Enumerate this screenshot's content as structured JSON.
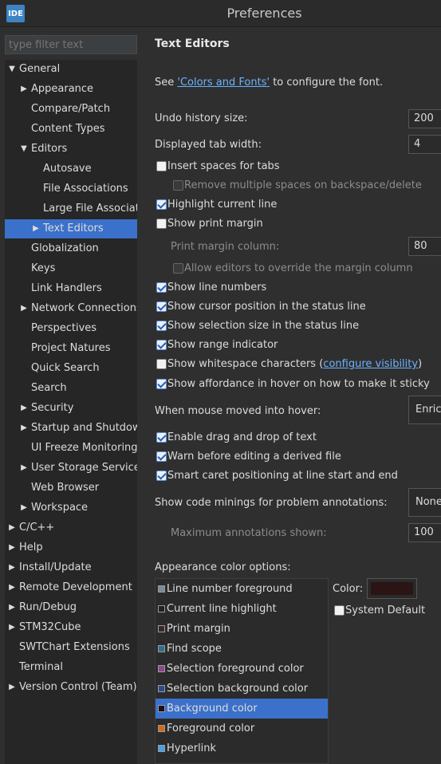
{
  "window": {
    "title": "Preferences",
    "logo": "IDE"
  },
  "filter": {
    "placeholder": "type filter text"
  },
  "tree": [
    {
      "label": "General",
      "depth": 0,
      "twisty": "open"
    },
    {
      "label": "Appearance",
      "depth": 1,
      "twisty": "closed"
    },
    {
      "label": "Compare/Patch",
      "depth": 1,
      "twisty": "none"
    },
    {
      "label": "Content Types",
      "depth": 1,
      "twisty": "none"
    },
    {
      "label": "Editors",
      "depth": 1,
      "twisty": "open"
    },
    {
      "label": "Autosave",
      "depth": 2,
      "twisty": "none"
    },
    {
      "label": "File Associations",
      "depth": 2,
      "twisty": "none"
    },
    {
      "label": "Large File Associatio",
      "depth": 2,
      "twisty": "none"
    },
    {
      "label": "Text Editors",
      "depth": 2,
      "twisty": "closed",
      "selected": true
    },
    {
      "label": "Globalization",
      "depth": 1,
      "twisty": "none"
    },
    {
      "label": "Keys",
      "depth": 1,
      "twisty": "none"
    },
    {
      "label": "Link Handlers",
      "depth": 1,
      "twisty": "none"
    },
    {
      "label": "Network Connections",
      "depth": 1,
      "twisty": "closed"
    },
    {
      "label": "Perspectives",
      "depth": 1,
      "twisty": "none"
    },
    {
      "label": "Project Natures",
      "depth": 1,
      "twisty": "none"
    },
    {
      "label": "Quick Search",
      "depth": 1,
      "twisty": "none"
    },
    {
      "label": "Search",
      "depth": 1,
      "twisty": "none"
    },
    {
      "label": "Security",
      "depth": 1,
      "twisty": "closed"
    },
    {
      "label": "Startup and Shutdown",
      "depth": 1,
      "twisty": "closed"
    },
    {
      "label": "UI Freeze Monitoring",
      "depth": 1,
      "twisty": "none"
    },
    {
      "label": "User Storage Service",
      "depth": 1,
      "twisty": "closed"
    },
    {
      "label": "Web Browser",
      "depth": 1,
      "twisty": "none"
    },
    {
      "label": "Workspace",
      "depth": 1,
      "twisty": "closed"
    },
    {
      "label": "C/C++",
      "depth": 0,
      "twisty": "closed"
    },
    {
      "label": "Help",
      "depth": 0,
      "twisty": "closed"
    },
    {
      "label": "Install/Update",
      "depth": 0,
      "twisty": "closed"
    },
    {
      "label": "Remote Development",
      "depth": 0,
      "twisty": "closed"
    },
    {
      "label": "Run/Debug",
      "depth": 0,
      "twisty": "closed"
    },
    {
      "label": "STM32Cube",
      "depth": 0,
      "twisty": "closed"
    },
    {
      "label": "SWTChart Extensions",
      "depth": 0,
      "twisty": "none"
    },
    {
      "label": "Terminal",
      "depth": 0,
      "twisty": "none"
    },
    {
      "label": "Version Control (Team)",
      "depth": 0,
      "twisty": "closed"
    }
  ],
  "page": {
    "title": "Text Editors",
    "see_prefix": "See ",
    "see_link": "'Colors and Fonts'",
    "see_suffix": " to configure the font.",
    "undo_label": "Undo history size:",
    "undo_value": "200",
    "tab_label": "Displayed tab width:",
    "tab_value": "4",
    "insert_spaces": "Insert spaces for tabs",
    "remove_spaces": "Remove multiple spaces on backspace/delete",
    "highlight_line": "Highlight current line",
    "show_print_margin": "Show print margin",
    "print_margin_label": "Print margin column:",
    "print_margin_value": "80",
    "allow_override": "Allow editors to override the margin column",
    "line_numbers": "Show line numbers",
    "cursor_pos": "Show cursor position in the status line",
    "selection_size": "Show selection size in the status line",
    "range_indicator": "Show range indicator",
    "whitespace_prefix": "Show whitespace characters (",
    "whitespace_link": "configure visibility",
    "whitespace_suffix": ")",
    "affordance": "Show affordance in hover on how to make it sticky",
    "hover_label": "When mouse moved into hover:",
    "hover_value": "Enric",
    "drag_drop": "Enable drag and drop of text",
    "warn_derived": "Warn before editing a derived file",
    "smart_caret": "Smart caret positioning at line start and end",
    "minings_label": "Show code minings for problem annotations:",
    "minings_value": "None",
    "max_annotations_label": "Maximum annotations shown:",
    "max_annotations_value": "100",
    "appearance_label": "Appearance color options:",
    "color_label": "Color:",
    "system_default": "System Default"
  },
  "checkboxes": {
    "insert_spaces": false,
    "remove_spaces": false,
    "highlight_line": true,
    "show_print_margin": false,
    "allow_override": false,
    "line_numbers": true,
    "cursor_pos": true,
    "selection_size": true,
    "range_indicator": true,
    "whitespace": false,
    "affordance": true,
    "drag_drop": true,
    "warn_derived": true,
    "smart_caret": true,
    "system_default": false
  },
  "color_options": [
    {
      "label": "Line number foreground",
      "color": "#7a8a96"
    },
    {
      "label": "Current line highlight",
      "color": "#2a1e1e"
    },
    {
      "label": "Print margin",
      "color": "#3a2a26"
    },
    {
      "label": "Find scope",
      "color": "#2e6f8e"
    },
    {
      "label": "Selection foreground color",
      "color": "#8a4a8a"
    },
    {
      "label": "Selection background color",
      "color": "#2e4a8a"
    },
    {
      "label": "Background color",
      "color": "#1a1212",
      "selected": true
    },
    {
      "label": "Foreground color",
      "color": "#d06a1a"
    },
    {
      "label": "Hyperlink",
      "color": "#4aa0e6"
    }
  ],
  "current_color": "#2a1414"
}
